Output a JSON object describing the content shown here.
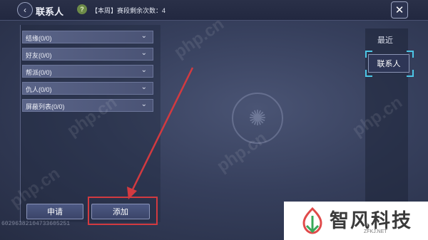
{
  "header": {
    "back_icon": "‹",
    "title": "联系人",
    "badge_icon": "?",
    "weekly_info": "【本周】赛段剩余次数：4",
    "close_icon": "✕"
  },
  "categories": [
    {
      "label": "结缘(0/0)"
    },
    {
      "label": "好友(0/0)"
    },
    {
      "label": "帮派(0/0)"
    },
    {
      "label": "仇人(0/0)"
    },
    {
      "label": "屏蔽列表(0/0)"
    }
  ],
  "buttons": {
    "apply": "申请",
    "add": "添加"
  },
  "tabs": {
    "recent": "最近",
    "contacts": "联系人"
  },
  "player_id": "60296382104733605251",
  "logo": {
    "name": "智风科技",
    "domain": "ZFKJ.NET"
  },
  "watermark_text": "php.cn",
  "colors": {
    "accent_cyan": "#4cc6e6",
    "annotation_red": "#d23a40"
  }
}
